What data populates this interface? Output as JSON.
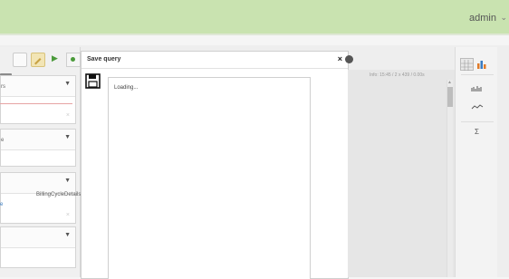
{
  "header": {
    "user_label": "admin",
    "user_menu_icon": "chevron-down-icon"
  },
  "sidebar": {
    "tooltip": "ery",
    "panels": [
      {
        "label": "rs"
      },
      {
        "label": "e"
      },
      {
        "label": "",
        "detail": "BillingCycleDetails",
        "link": "e"
      },
      {
        "label": ""
      }
    ]
  },
  "dialog": {
    "title": "Save query",
    "close_symbol": "×",
    "editor_text": "Loading..."
  },
  "result": {
    "info_text": "Info: 15:45  / 2 x 439 / 0.00s"
  },
  "rail": {
    "sigma": "Σ"
  },
  "colors": {
    "header_bg": "#c9e3b0",
    "run_green": "#4a9a3a",
    "link_blue": "#3a7cc2"
  }
}
